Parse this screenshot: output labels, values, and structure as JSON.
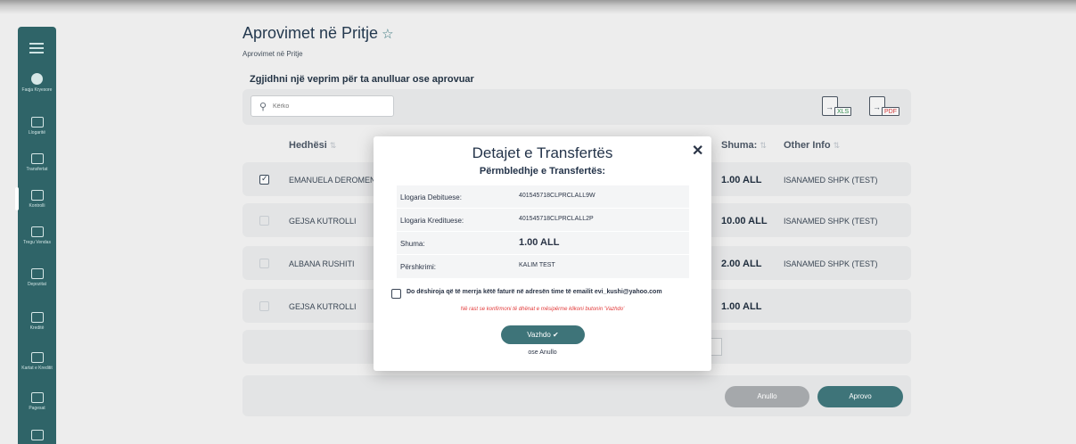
{
  "sidebar": {
    "items": [
      {
        "label": "Faqja Kryesore",
        "icon": "home-icon"
      },
      {
        "label": "Llogaritë",
        "icon": "wallet-icon"
      },
      {
        "label": "Transfertat",
        "icon": "transfer-icon"
      },
      {
        "label": "Kontrolli",
        "icon": "control-icon"
      },
      {
        "label": "Tregu Vendas",
        "icon": "market-icon"
      },
      {
        "label": "Depozitat",
        "icon": "deposit-icon"
      },
      {
        "label": "Kreditë",
        "icon": "credit-icon"
      },
      {
        "label": "Kartat e Kreditit",
        "icon": "card-icon"
      },
      {
        "label": "Pagesat",
        "icon": "payment-icon"
      }
    ]
  },
  "header": {
    "title": "Aprovimet në Pritje",
    "breadcrumb": "Aprovimet në Pritje",
    "subtitle": "Zgjidhni një veprim për ta anulluar ose aprovuar"
  },
  "search": {
    "placeholder": "Kërko"
  },
  "exports": {
    "xls": "XLS",
    "pdf": "PDF"
  },
  "table": {
    "columns": {
      "payer": "Hedhësi",
      "amount": "Shuma:",
      "info": "Other Info"
    },
    "rows": [
      {
        "name": "EMANUELA DEROMEN",
        "amount": "1.00 ALL",
        "info": "ISANAMED SHPK (TEST)",
        "checked": true
      },
      {
        "name": "GEJSA KUTROLLI",
        "amount": "10.00 ALL",
        "info": "ISANAMED SHPK (TEST)",
        "checked": false
      },
      {
        "name": "ALBANA RUSHITI",
        "amount": "2.00 ALL",
        "info": "ISANAMED SHPK (TEST)",
        "checked": false
      },
      {
        "name": "GEJSA KUTROLLI",
        "amount": "1.00 ALL",
        "info": "",
        "checked": false
      }
    ]
  },
  "actions": {
    "cancel": "Anullo",
    "approve": "Aprovo"
  },
  "modal": {
    "title": "Detajet e Transfertës",
    "subtitle": "Përmbledhje e Transfertës:",
    "details": {
      "debit_label": "Llogaria Debituese:",
      "debit_value": "401545718CLPRCLALL9W",
      "credit_label": "Llogaria Kredituese:",
      "credit_value": "401545718CLPRCLALL2P",
      "amount_label": "Shuma:",
      "amount_value": "1.00 ALL",
      "desc_label": "Përshkrimi:",
      "desc_value": "KALIM TEST"
    },
    "email_checkbox": "Do dëshiroja që të merrja këtë faturë në adresën time të emailit evi_kushi@yahoo.com",
    "note": "Në rast se konfirmoni të dhënat e mësipërme klikoni butonin 'Vazhdo'",
    "continue": "Vazhdo ✔",
    "or_cancel": "ose Anullo",
    "close": "✕"
  },
  "colors": {
    "primary": "#3e7479",
    "sidebar": "#2f6468",
    "danger": "#e23a3a",
    "muted_button": "#a5a8ab"
  }
}
